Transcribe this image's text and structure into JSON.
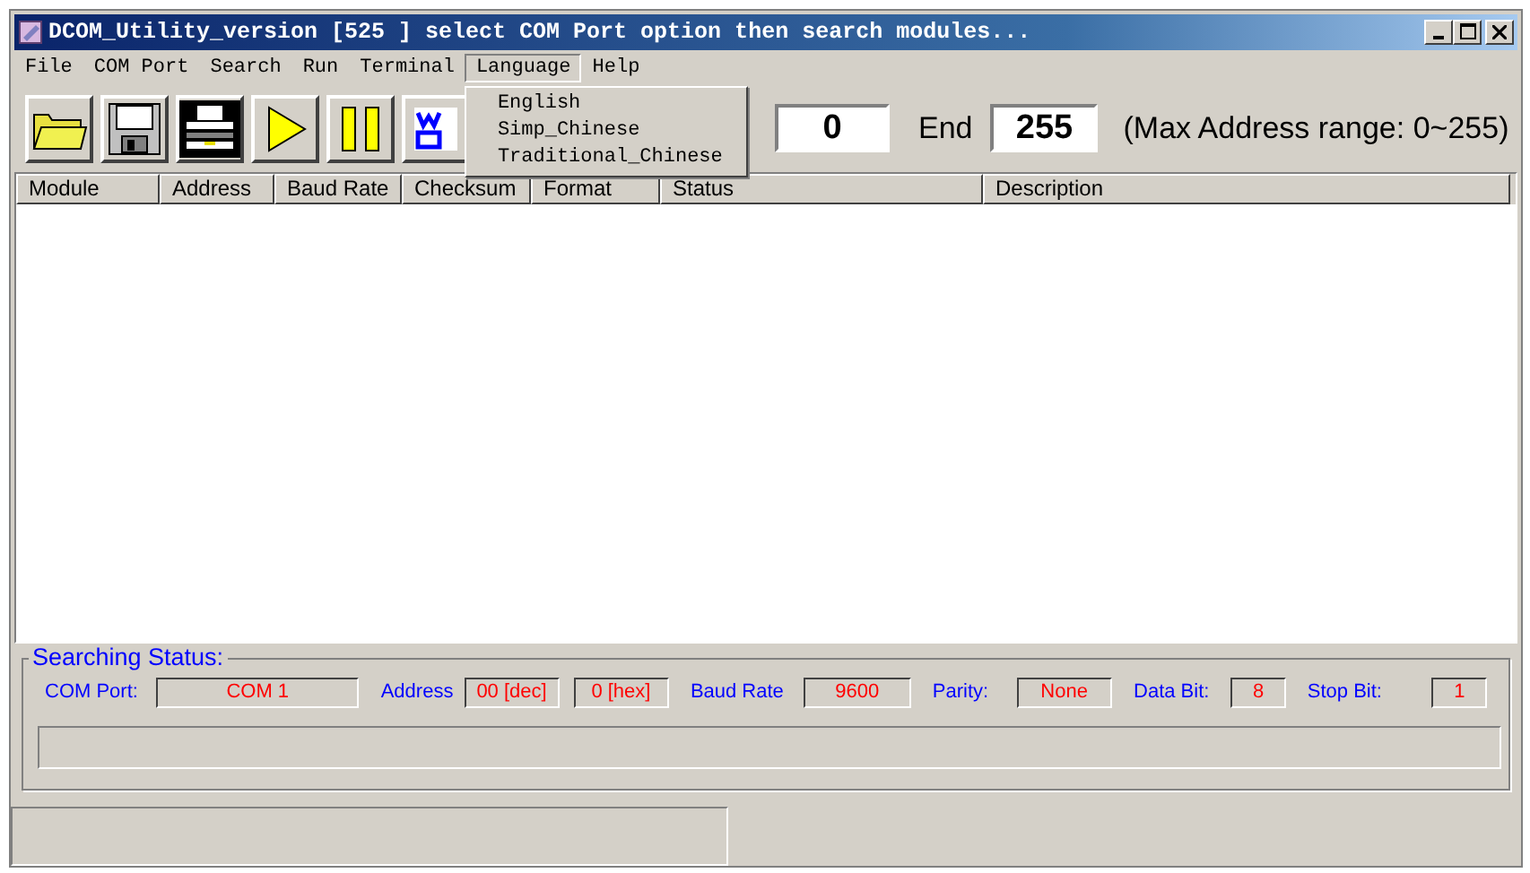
{
  "window": {
    "title": "DCOM_Utility_version [525  ] select COM Port option then search modules..."
  },
  "menu": [
    {
      "label": "File",
      "open": false
    },
    {
      "label": "COM Port",
      "open": false
    },
    {
      "label": "Search",
      "open": false
    },
    {
      "label": "Run",
      "open": false
    },
    {
      "label": "Terminal",
      "open": false
    },
    {
      "label": "Language",
      "open": true,
      "items": [
        "English",
        "Simp_Chinese",
        "Traditional_Chinese"
      ]
    },
    {
      "label": "Help",
      "open": false
    }
  ],
  "toolbar": {
    "buttons": [
      {
        "kind": "open"
      },
      {
        "kind": "save"
      },
      {
        "kind": "print"
      },
      {
        "kind": "play"
      },
      {
        "kind": "pause"
      },
      {
        "kind": "wizard"
      }
    ],
    "start_value": "0",
    "end_label": "End",
    "end_value": "255",
    "range_note": "(Max Address range: 0~255)"
  },
  "table": {
    "columns": [
      "Module",
      "Address",
      "Baud Rate",
      "Checksum",
      "Format",
      "Status",
      "Description"
    ]
  },
  "search_status": {
    "title": "Searching Status:",
    "fields": [
      {
        "label": "COM Port:",
        "values": [
          "COM 1"
        ]
      },
      {
        "label": "Address",
        "values": [
          "00 [dec]",
          "0 [hex]"
        ]
      },
      {
        "label": "Baud Rate",
        "values": [
          "9600"
        ]
      },
      {
        "label": "Parity:",
        "values": [
          "None"
        ]
      },
      {
        "label": "Data Bit:",
        "values": [
          "8"
        ]
      },
      {
        "label": "Stop Bit:",
        "values": [
          "1"
        ]
      }
    ],
    "progress": {
      "level": 0
    }
  }
}
